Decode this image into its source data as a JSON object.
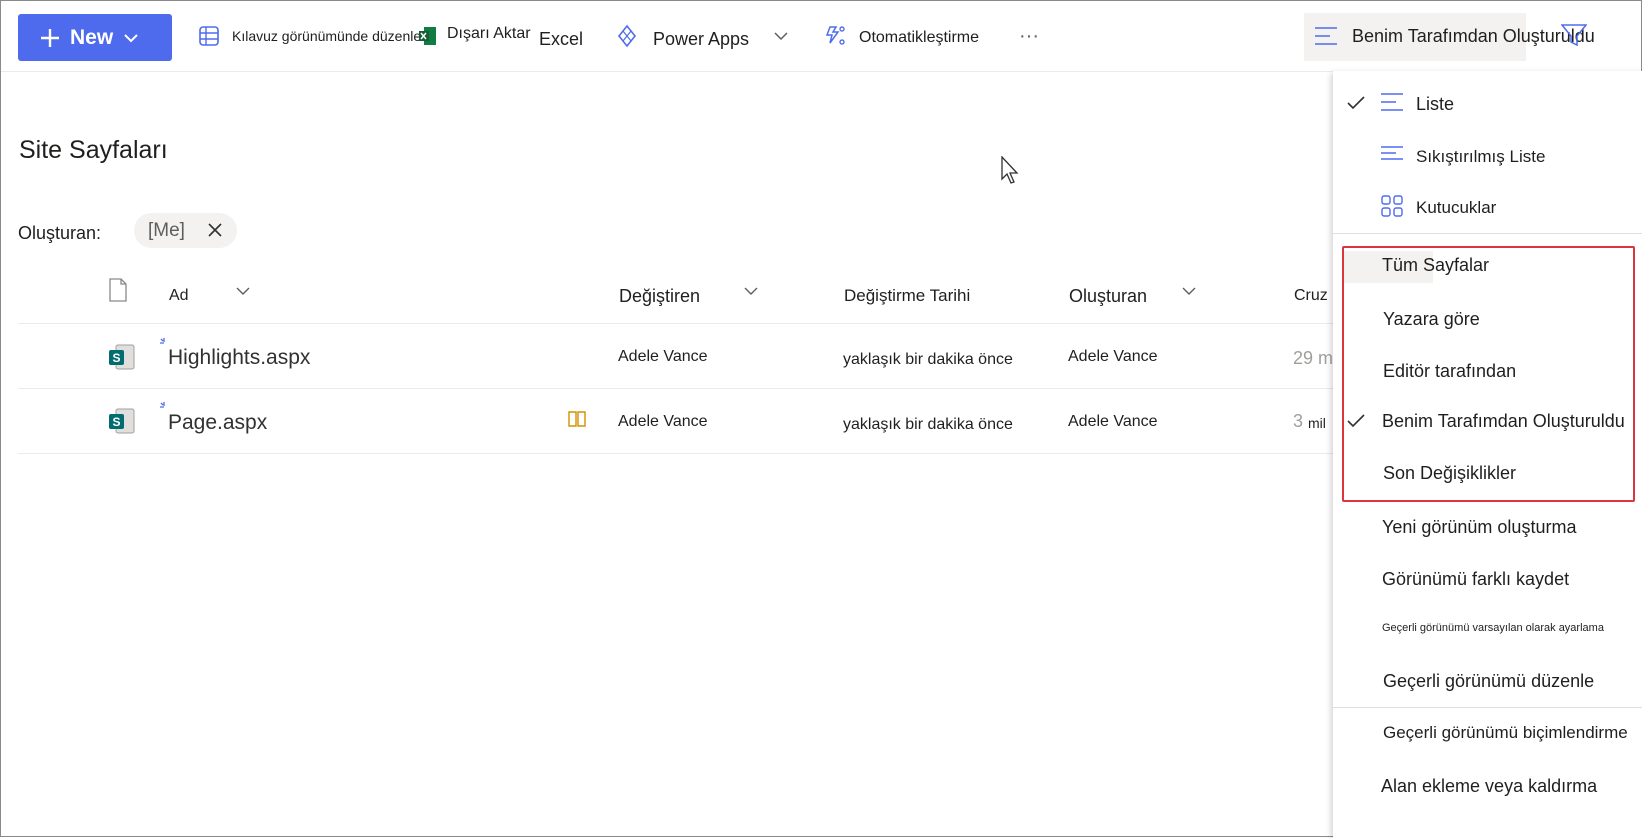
{
  "toolbar": {
    "new_label": "New",
    "grid_edit_label": "Kılavuz görünümünde düzenle",
    "export_label": "Dışarı Aktar",
    "excel_label": "Excel",
    "powerapps_label": "Power Apps",
    "automate_label": "Otomatikleştirme",
    "more_label": "···",
    "view_selector_label": "Benim Tarafımdan Oluşturuldu"
  },
  "page": {
    "title": "Site Sayfaları",
    "filter_label": "Oluşturan:",
    "filter_pill": "[Me]"
  },
  "table": {
    "headers": {
      "name": "Ad",
      "modified_by": "Değiştiren",
      "modified": "Değiştirme Tarihi",
      "created_by": "Oluşturan",
      "created": "Cruz"
    },
    "rows": [
      {
        "name": "Highlights.aspx",
        "modified_by": "Adele Vance",
        "modified": "yaklaşık bir dakika önce",
        "created_by": "Adele Vance",
        "created": "29 m"
      },
      {
        "name": "Page.aspx",
        "modified_by": "Adele Vance",
        "modified": "yaklaşık bir dakika önce",
        "created_by": "Adele Vance",
        "created": "3",
        "created_suffix": "mil"
      }
    ]
  },
  "menu": {
    "layouts": [
      {
        "label": "Liste",
        "checked": true
      },
      {
        "label": "Sıkıştırılmış Liste",
        "checked": false
      },
      {
        "label": "Kutucuklar",
        "checked": false
      }
    ],
    "views": [
      {
        "label": "Tüm Sayfalar",
        "checked": false
      },
      {
        "label": "Yazara göre",
        "checked": false
      },
      {
        "label": "Editör tarafından",
        "checked": false
      },
      {
        "label": "Benim Tarafımdan Oluşturuldu",
        "checked": true
      },
      {
        "label": "Son Değişiklikler",
        "checked": false
      }
    ],
    "actions": [
      "Yeni görünüm oluşturma",
      "Görünümü farklı kaydet",
      "Geçerli görünümü varsayılan olarak ayarlama",
      "Geçerli görünümü düzenle",
      "Geçerli görünümü biçimlendirme",
      "Alan ekleme veya kaldırma"
    ]
  },
  "colors": {
    "accent": "#4f6bed",
    "highlight_box": "#d9363e",
    "sharepoint_green": "#036c70"
  }
}
